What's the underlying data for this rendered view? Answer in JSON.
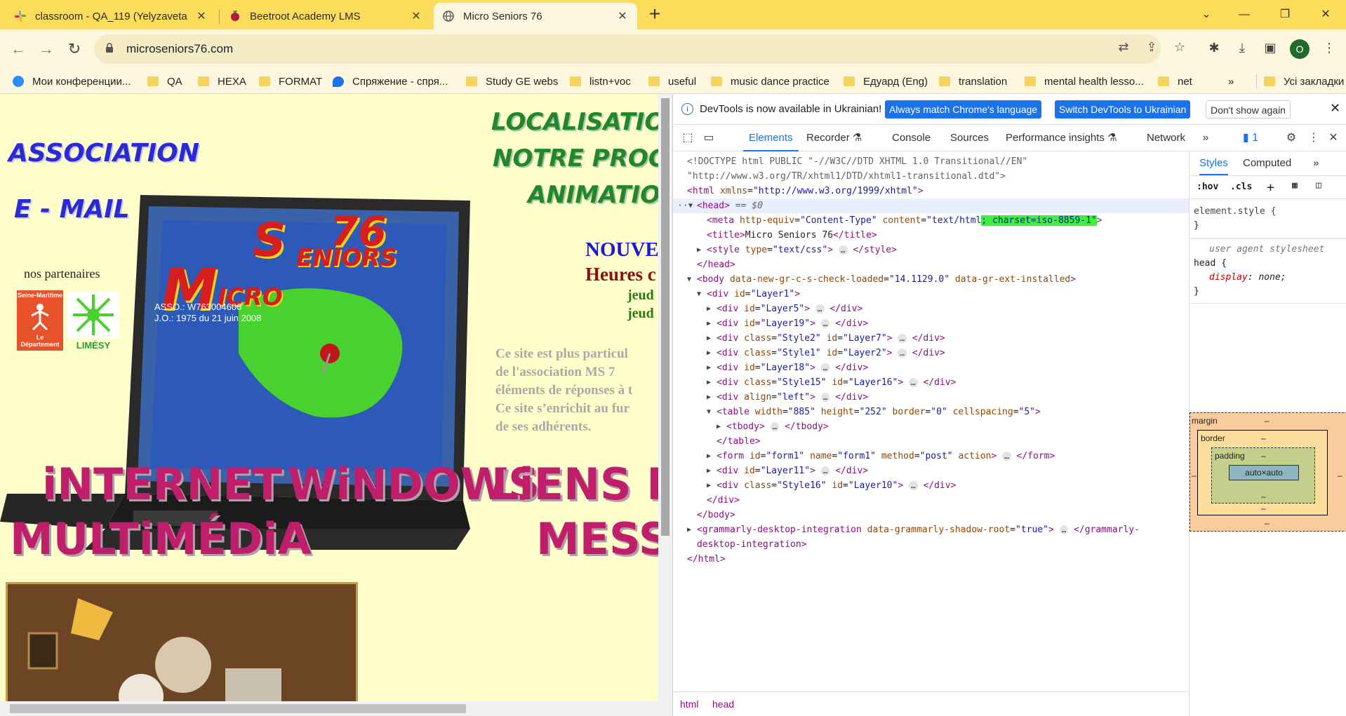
{
  "browser": {
    "tabs": [
      {
        "title": "classroom - QA_119 (Yelyzaveta",
        "icon": "slack-icon"
      },
      {
        "title": "Beetroot Academy LMS",
        "icon": "beetroot-icon"
      },
      {
        "title": "Micro Seniors 76",
        "icon": "globe-icon",
        "active": true
      }
    ],
    "url": "microseniors76.com",
    "profile_initial": "O",
    "bookmarks": [
      {
        "label": "Мои конференции...",
        "icon": "zoom-icon"
      },
      {
        "label": "QA",
        "icon": "folder-icon"
      },
      {
        "label": "HEXA",
        "icon": "folder-icon"
      },
      {
        "label": "FORMAT",
        "icon": "folder-icon"
      },
      {
        "label": "Спряжение - спря...",
        "icon": "reverso-icon"
      },
      {
        "label": "Study GE webs",
        "icon": "folder-icon"
      },
      {
        "label": "listn+voc",
        "icon": "folder-icon"
      },
      {
        "label": "useful",
        "icon": "folder-icon"
      },
      {
        "label": "music dance practice",
        "icon": "folder-icon"
      },
      {
        "label": "Едуард (Eng)",
        "icon": "folder-icon"
      },
      {
        "label": "translation",
        "icon": "folder-icon"
      },
      {
        "label": "mental health lesso...",
        "icon": "folder-icon"
      },
      {
        "label": "net",
        "icon": "folder-icon"
      }
    ],
    "bookmarks_overflow": "»",
    "all_bookmarks": "Усі закладки"
  },
  "site": {
    "association": "ASSOCIATION",
    "email": "E - MAIL",
    "partners": "nos partenaires",
    "partner1_line1": "Seine-Maritime",
    "partner1_line2": "Le Département",
    "partner2": "LIMÉSY",
    "logo_76": "76",
    "logo_seniors": "ENIORS",
    "logo_s": "S",
    "logo_m": "M",
    "logo_icro": "ICRO",
    "assoc_no": "ASSO.: W763004606",
    "jo": "J.O.: 1975 du 21 juin 2008",
    "localisation": "LOCALISATION D",
    "programme": "NOTRE PROGR",
    "animation": "ANIMATIO",
    "nouve": "NOUVE",
    "heures": "Heures c",
    "jeudi1": "jeud",
    "jeudi2": "jeud",
    "para1": "Ce site est plus particul",
    "para2": "de l'association MS 7",
    "para3": "éléments de réponses à t",
    "para4": "Ce site s’enrichit au fur",
    "para5": "de ses adhérents.",
    "internet": "iNTERNET",
    "windows": "WiNDOWS",
    "liens": "LiENS PR",
    "multimedia": "MULTiMÉDiA",
    "messa": "MESSA"
  },
  "devtools": {
    "infobar": {
      "text": "DevTools is now available in Ukrainian!",
      "btn_match": "Always match Chrome's language",
      "btn_switch": "Switch DevTools to Ukrainian",
      "btn_dont": "Don't show again"
    },
    "tabs": [
      "Elements",
      "Recorder",
      "Console",
      "Sources",
      "Performance insights",
      "Network"
    ],
    "issues_count": "1",
    "styles_tabs": [
      "Styles",
      "Computed"
    ],
    "filter_hov": ":hov",
    "filter_cls": ".cls",
    "element_style": "element.style {",
    "close_brace": "}",
    "ua_label": "user agent stylesheet",
    "head_rule": "head {",
    "display_prop": "display",
    "display_val": "none;",
    "box": {
      "margin": "margin",
      "border": "border",
      "padding": "padding",
      "content": "auto×auto",
      "dash": "–"
    },
    "breadcrumbs": [
      "html",
      "head"
    ],
    "dom": {
      "doctype1": "<!DOCTYPE html PUBLIC \"-//W3C//DTD XHTML 1.0 Transitional//EN\"",
      "doctype2": "\"http://www.w3.org/TR/xhtml1/DTD/xhtml1-transitional.dtd\">",
      "html_open_a": "<html",
      "html_attr": "xmlns",
      "html_val": "\"http://www.w3.org/1999/xhtml\"",
      "head_open": "<head>",
      "head_eq": "== $0",
      "meta_tag": "<meta",
      "meta_a1": "http-equiv",
      "meta_v1": "\"Content-Type\"",
      "meta_a2": "content",
      "meta_v2a": "\"text/html",
      "meta_v2b": "; charset=iso-8859-1\"",
      "title_open": "<title>",
      "title_text": "Micro Seniors 76",
      "title_close": "</title>",
      "style_open": "<style",
      "style_a": "type",
      "style_v": "\"text/css\"",
      "style_close": "</style>",
      "head_close": "</head>",
      "body_open": "<body",
      "body_a1": "data-new-gr-c-s-check-loaded",
      "body_v1": "\"14.1129.0\"",
      "body_a2": "data-gr-ext-installed",
      "div_layer1": "\"Layer1\"",
      "div_layer5": "\"Layer5\"",
      "div_layer19": "\"Layer19\"",
      "style2": "\"Style2\"",
      "layer7": "\"Layer7\"",
      "style1": "\"Style1\"",
      "layer2": "\"Layer2\"",
      "layer18": "\"Layer18\"",
      "style15": "\"Style15\"",
      "layer16": "\"Layer16\"",
      "align_left": "\"left\"",
      "tbl_width": "\"885\"",
      "tbl_height": "\"252\"",
      "tbl_border": "\"0\"",
      "tbl_cellspacing": "\"5\"",
      "form_id": "\"form1\"",
      "form_name": "\"form1\"",
      "form_method": "\"post\"",
      "layer11": "\"Layer11\"",
      "style16": "\"Style16\"",
      "layer10": "\"Layer10\"",
      "gram_open": "<grammarly-desktop-integration",
      "gram_a": "data-grammarly-shadow-root",
      "gram_v": "\"true\"",
      "gram_close1": "</grammarly-",
      "gram_close2": "desktop-integration>",
      "html_close": "</html>",
      "ellipsis": "…"
    }
  }
}
